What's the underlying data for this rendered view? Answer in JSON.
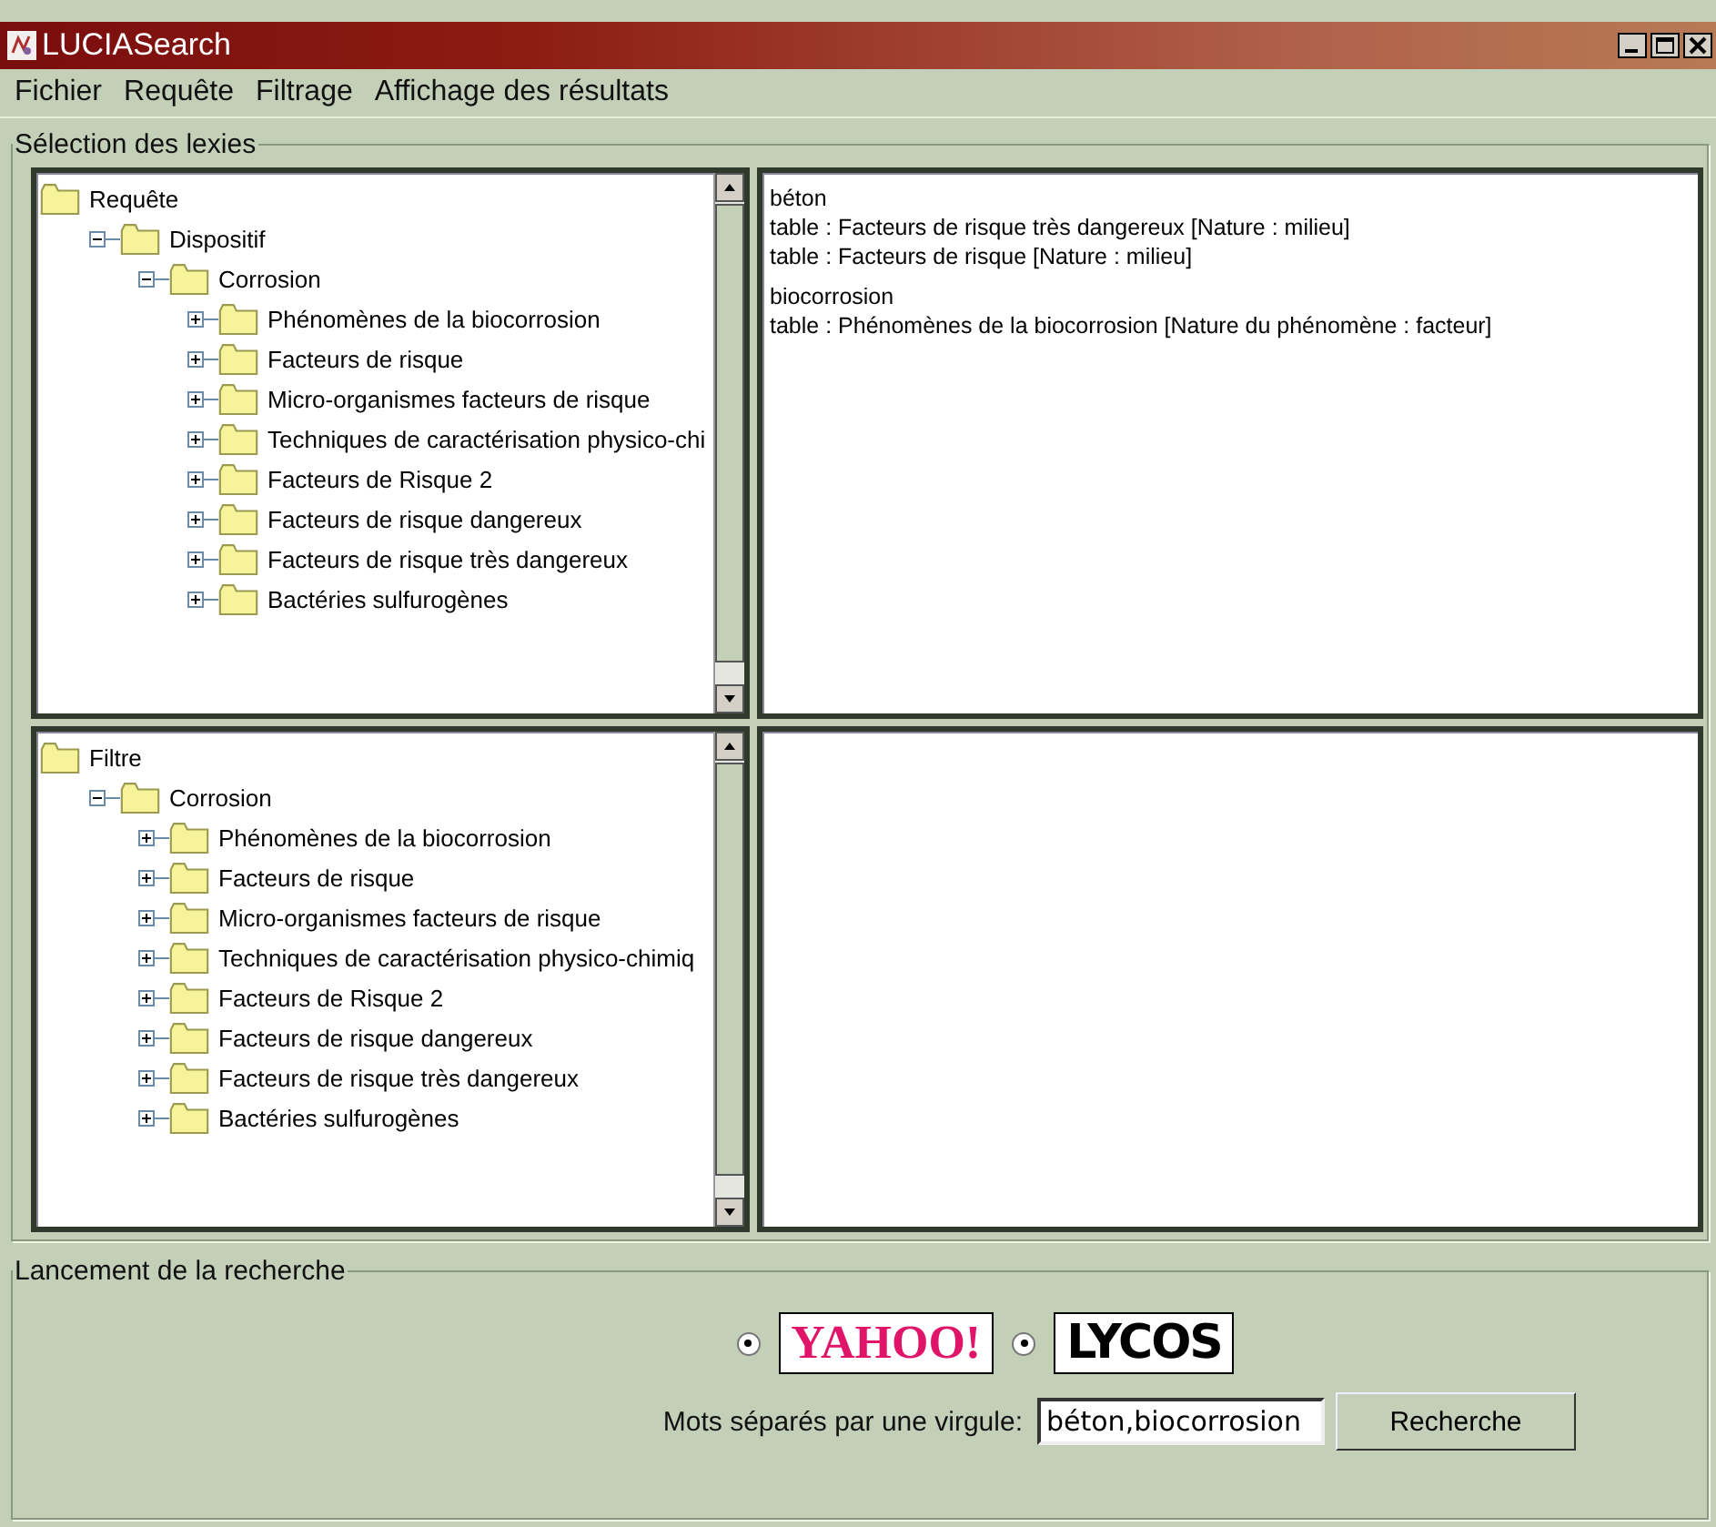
{
  "window": {
    "title": "LUCIASearch"
  },
  "menu": [
    "Fichier",
    "Requête",
    "Filtrage",
    "Affichage des résultats"
  ],
  "selection": {
    "title": "Sélection des lexies",
    "trees": [
      {
        "nodes": [
          {
            "label": "Requête",
            "children": [
              {
                "label": "Dispositif",
                "expanded": true,
                "children": [
                  {
                    "label": "Corrosion",
                    "expanded": true,
                    "children": [
                      {
                        "label": "Phénomènes de la biocorrosion",
                        "expanded": false
                      },
                      {
                        "label": "Facteurs de risque",
                        "expanded": false
                      },
                      {
                        "label": "Micro-organismes facteurs de risque",
                        "expanded": false
                      },
                      {
                        "label": "Techniques de caractérisation physico-chi",
                        "expanded": false
                      },
                      {
                        "label": "Facteurs de Risque 2",
                        "expanded": false
                      },
                      {
                        "label": "Facteurs de risque dangereux",
                        "expanded": false
                      },
                      {
                        "label": "Facteurs de risque très dangereux",
                        "expanded": false
                      },
                      {
                        "label": "Bactéries sulfurogènes",
                        "expanded": false
                      }
                    ]
                  }
                ]
              }
            ]
          }
        ]
      },
      {
        "nodes": [
          {
            "label": "Filtre",
            "children": [
              {
                "label": "Corrosion",
                "expanded": true,
                "children": [
                  {
                    "label": "Phénomènes de la biocorrosion",
                    "expanded": false
                  },
                  {
                    "label": "Facteurs de risque",
                    "expanded": false
                  },
                  {
                    "label": "Micro-organismes facteurs de risque",
                    "expanded": false
                  },
                  {
                    "label": "Techniques de caractérisation physico-chimiq",
                    "expanded": false
                  },
                  {
                    "label": "Facteurs de Risque 2",
                    "expanded": false
                  },
                  {
                    "label": "Facteurs de risque dangereux",
                    "expanded": false
                  },
                  {
                    "label": "Facteurs de risque très dangereux",
                    "expanded": false
                  },
                  {
                    "label": "Bactéries sulfurogènes",
                    "expanded": false
                  }
                ]
              }
            ]
          }
        ]
      }
    ],
    "results": [
      {
        "term": "béton",
        "lines": [
          "table : Facteurs de risque très dangereux  [Nature : milieu]",
          "table : Facteurs de risque  [Nature : milieu]"
        ]
      },
      {
        "term": "biocorrosion",
        "lines": [
          "table : Phénomènes de la biocorrosion [Nature du phénomène : facteur]"
        ]
      }
    ]
  },
  "search": {
    "title": "Lancement de la recherche",
    "engines": [
      {
        "kind": "yahoo",
        "label": "YAHOO!",
        "selected": true
      },
      {
        "kind": "lycos",
        "label": "LYCOS",
        "selected": true
      }
    ],
    "field_label": "Mots séparés par une virgule:",
    "value": "béton,biocorrosion",
    "button": "Recherche"
  }
}
